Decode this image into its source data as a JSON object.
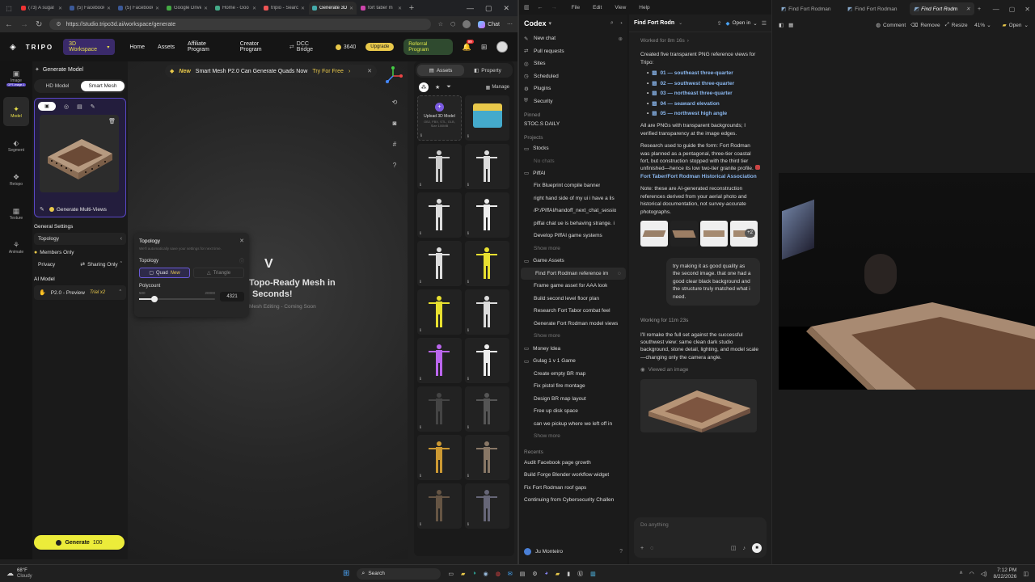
{
  "chrome": {
    "tabs": [
      "(73) A sugal",
      "(5) Facebook",
      "(5) Facebook",
      "Google Drive",
      "Home - Goo",
      "tripio - Searc",
      "Generate 3D",
      "fort taber m"
    ],
    "url": "https://studio.tripo3d.ai/workspace/generate",
    "chat_label": "Chat"
  },
  "tripo": {
    "brand": "TRIPO",
    "workspace": "3D Workspace",
    "nav": [
      "Home",
      "Assets",
      "Affiliate Program",
      "Creator Program"
    ],
    "dcc": "DCC Bridge",
    "credits": "3640",
    "upgrade": "Upgrade",
    "referral": "Referral Program",
    "notif_count": "99",
    "rail": [
      "Image",
      "Model",
      "Segment",
      "Retopo",
      "Texture",
      "Animate"
    ],
    "rail_badge": "GPT-Image-1",
    "panel_title": "Generate Model",
    "mode_hd": "HD Model",
    "mode_smart": "Smart Mesh",
    "gen_multiviews": "Generate Multi-Views",
    "general_settings": "General Settings",
    "topology_label": "Topology",
    "members_only": "Members Only",
    "privacy": "Privacy",
    "sharing": "Sharing Only",
    "ai_model": "AI Model",
    "model_version": "P2.0 - Preview",
    "trial": "Trial x2",
    "generate_btn": "Generate",
    "generate_cost": "100",
    "banner_new": "New",
    "banner_text": "Smart Mesh P2.0 Can Generate Quads Now",
    "banner_cta": "Try For Free",
    "popup": {
      "title": "Topology",
      "sub": "We'll automatically save your settings for next time.",
      "section": "Topology",
      "quad": "Quad",
      "quad_new": "New",
      "triangle": "Triangle",
      "polycount": "Polycount",
      "min": "500",
      "max": "20000",
      "value": "4321",
      "slider_fraction": 0.2
    },
    "center_title": "Topo-Ready Mesh in",
    "center_title2": "Seconds!",
    "center_sub": "Mesh Editing - Coming Soon",
    "assets_tab": "Assets",
    "property_tab": "Property",
    "manage": "Manage",
    "upload_title": "Upload 3D Model",
    "upload_formats": "OBJ, FBX, STL, GLB, Size 100MB"
  },
  "codex": {
    "menu": [
      "File",
      "Edit",
      "View",
      "Help"
    ],
    "app": "Codex",
    "top_items": [
      "New chat",
      "Pull requests",
      "Sites",
      "Scheduled",
      "Plugins",
      "Security"
    ],
    "pinned_label": "Pinned",
    "pinned": [
      "STOC.S DAILY"
    ],
    "projects_label": "Projects",
    "projects": [
      {
        "name": "Stocks",
        "items": [],
        "empty": "No chats",
        "more": ""
      },
      {
        "name": "PiffAI",
        "items": [
          "Fix Blueprint compile banner",
          "right hand side of my ui i have a lis",
          "/P:/PiffAI/handoff_next_chat_sessio",
          "piffai chat ue is behaving strange. i",
          "Develop PiffAI game systems"
        ],
        "empty": "",
        "more": "Show more"
      },
      {
        "name": "Game Assets",
        "items": [
          "Find Fort Rodman reference im",
          "Frame game asset for AAA look",
          "Build second level floor plan",
          "Research Fort Tabor combat feel",
          "Generate Fort Rodman model views"
        ],
        "empty": "",
        "more": "Show more"
      },
      {
        "name": "Money Idea",
        "items": [],
        "empty": "",
        "more": ""
      },
      {
        "name": "Gulag 1 v 1 Game",
        "items": [
          "Create empty BR map",
          "Fix pistol fire montage",
          "Design BR map layout",
          "Free up disk space",
          "can we pickup where we left off in"
        ],
        "empty": "",
        "more": "Show more"
      }
    ],
    "recents_label": "Recents",
    "recents": [
      "Audit Facebook page growth",
      "Build Forge Blender workflow widget",
      "Fix Fort Rodman roof gaps",
      "Continuing from Cybersecurity Challen"
    ],
    "user": "Ju Monteiro",
    "thread_title": "Find Fort Rodn",
    "open_in": "Open in",
    "worked": "Worked for 8m 16s",
    "intro": "Created five transparent PNG reference views for Tripo:",
    "files": [
      "01 — southeast three-quarter",
      "02 — southwest three-quarter",
      "03 — northeast three-quarter",
      "04 — seaward elevation",
      "05 — northwest high angle"
    ],
    "para1": "All are PNGs with transparent backgrounds; I verified transparency at the image edges.",
    "para2": "Research used to guide the form: Fort Rodman was planned as a pentagonal, three-tier coastal fort, but construction stopped with the third tier unfinished—hence its low two-tier granite profile.",
    "source": "Fort Taber/Fort Rodman Historical Association",
    "para3": "Note: these are AI-generated reconstruction references derived from your aerial photo and historical documentation, not survey-accurate photographs.",
    "thumb_more": "+2",
    "user_msg": "try making it as good quality as the second image. that one had a good clear black background and the structure truly matched what i need.",
    "working": "Working for 11m 23s",
    "para4": "I'll remake the full set against the successful southwest view: same clean dark studio background, stone detail, lighting, and model scale—changing only the camera angle.",
    "viewed": "Viewed an image",
    "input_placeholder": "Do anything"
  },
  "viewer": {
    "tabs": [
      "Find Fort Rodman",
      "Find Fort Rodman",
      "Find Fort Rodm"
    ],
    "comment": "Comment",
    "remove": "Remove",
    "resize": "Resize",
    "zoom": "41%",
    "open": "Open"
  },
  "taskbar": {
    "temp": "68°F",
    "weather": "Cloudy",
    "search": "Search",
    "time": "7:12 PM",
    "date": "8/22/2026"
  }
}
